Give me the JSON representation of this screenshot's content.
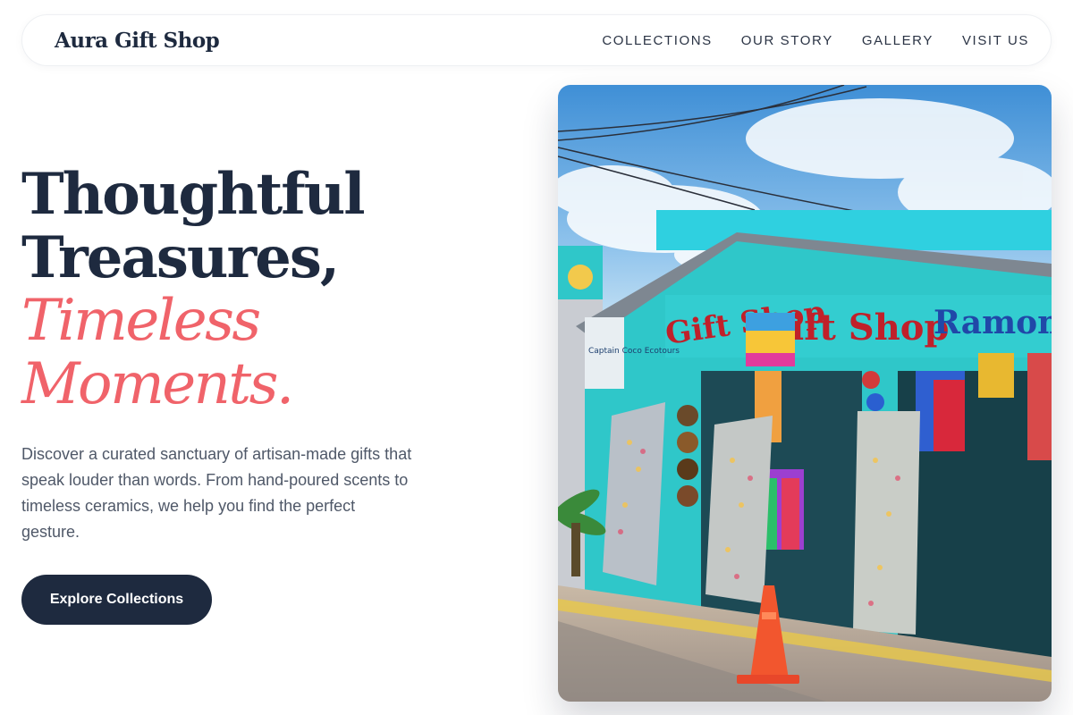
{
  "nav": {
    "logo": "Aura Gift Shop",
    "links": [
      "COLLECTIONS",
      "OUR STORY",
      "GALLERY",
      "VISIT US"
    ]
  },
  "hero": {
    "headline_line1": "Thoughtful",
    "headline_line2": "Treasures,",
    "headline_line3": "Timeless",
    "headline_line4": "Moments.",
    "description": "Discover a curated sanctuary of artisan-made gifts that speak louder than words. From hand-poured scents to timeless ceramics, we help you find the perfect gesture.",
    "cta_label": "Explore Collections"
  },
  "photo": {
    "sign_left": "Gift Shop",
    "sign_main": "ift Shop",
    "sign_right": "Ramon",
    "sign_tour": "Captain Coco Ecotours"
  },
  "colors": {
    "navy": "#1e2a3f",
    "accent": "#f0636a",
    "shop_teal": "#2fc7c9"
  }
}
